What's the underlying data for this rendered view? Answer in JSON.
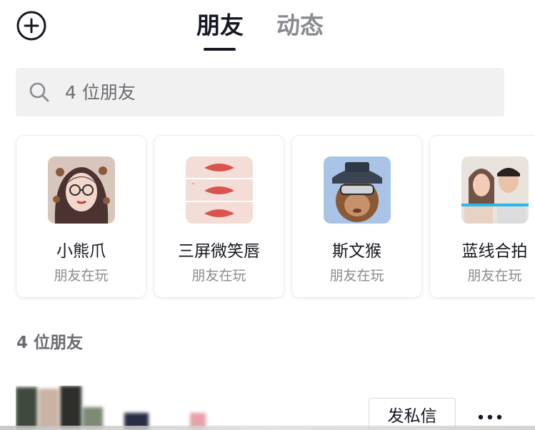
{
  "header": {
    "add_icon": "plus-circle-icon",
    "tabs": [
      {
        "label": "朋友",
        "active": true
      },
      {
        "label": "动态",
        "active": false
      }
    ]
  },
  "search": {
    "icon": "search-icon",
    "placeholder": "4 位朋友"
  },
  "effect_cards": [
    {
      "title": "小熊爪",
      "subtitle": "朋友在玩"
    },
    {
      "title": "三屏微笑唇",
      "subtitle": "朋友在玩"
    },
    {
      "title": "斯文猴",
      "subtitle": "朋友在玩"
    },
    {
      "title": "蓝线合拍",
      "subtitle": "朋友在玩"
    }
  ],
  "friends_section": {
    "label": "4 位朋友"
  },
  "friend_row": {
    "message_button": "发私信",
    "more_icon": "more-dots-icon"
  },
  "colors": {
    "text_primary": "#161823",
    "text_secondary": "#8a8b91",
    "search_bg": "#f1f1f2"
  }
}
